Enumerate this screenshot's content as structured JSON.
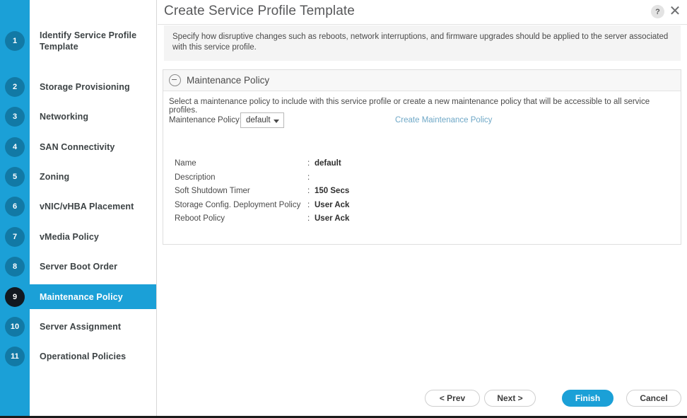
{
  "window": {
    "title": "Create Service Profile Template",
    "help_icon_label": "?",
    "close_icon_label": "✕",
    "description": "Specify how disruptive changes such as reboots, network interruptions, and firmware upgrades should be applied to the server associated with this service profile."
  },
  "sidebar": {
    "steps": [
      {
        "number": "1",
        "label": "Identify Service Profile Template",
        "active": false
      },
      {
        "number": "2",
        "label": "Storage Provisioning",
        "active": false
      },
      {
        "number": "3",
        "label": "Networking",
        "active": false
      },
      {
        "number": "4",
        "label": "SAN Connectivity",
        "active": false
      },
      {
        "number": "5",
        "label": "Zoning",
        "active": false
      },
      {
        "number": "6",
        "label": "vNIC/vHBA Placement",
        "active": false
      },
      {
        "number": "7",
        "label": "vMedia Policy",
        "active": false
      },
      {
        "number": "8",
        "label": "Server Boot Order",
        "active": false
      },
      {
        "number": "9",
        "label": "Maintenance Policy",
        "active": true
      },
      {
        "number": "10",
        "label": "Server Assignment",
        "active": false
      },
      {
        "number": "11",
        "label": "Operational Policies",
        "active": false
      }
    ]
  },
  "panel": {
    "title": "Maintenance Policy",
    "collapse_icon": "circle-minus-icon",
    "instructions": "Select a maintenance policy to include with this service profile or create a new maintenance policy that will be accessible to all service profiles.",
    "policy_label": "Maintenance Policy:",
    "policy_selected": "default",
    "policy_options": [
      "default"
    ],
    "create_link": "Create Maintenance Policy",
    "details": [
      {
        "key": "Name",
        "colon": ":",
        "value": "default"
      },
      {
        "key": "Description",
        "colon": ":",
        "value": ""
      },
      {
        "key": "Soft Shutdown Timer",
        "colon": ":",
        "value": "150 Secs"
      },
      {
        "key": "Storage Config. Deployment Policy",
        "colon": ":",
        "value": "User Ack"
      },
      {
        "key": "Reboot Policy",
        "colon": ":",
        "value": "User Ack"
      }
    ]
  },
  "footer": {
    "prev": "< Prev",
    "next": "Next >",
    "finish": "Finish",
    "cancel": "Cancel"
  },
  "colors": {
    "accent_blue": "#1ba0d7",
    "badge_blue": "#1279a5",
    "active_badge": "#111820",
    "link_blue": "#6fa8c7",
    "banner_gray": "#f4f4f4"
  }
}
